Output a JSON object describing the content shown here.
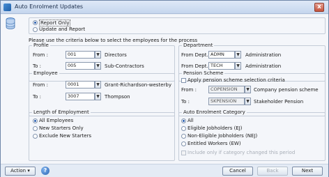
{
  "window": {
    "title": "Auto Enrolment Updates",
    "close_glyph": "x"
  },
  "mode": {
    "report_only": "Report Only",
    "update_and_report": "Update and Report",
    "selected": "report_only"
  },
  "criteria_prompt": "Please use the criteria below to select the employees for the process",
  "profile": {
    "label": "Profile",
    "from_label": "From :",
    "from_value": "001",
    "from_desc": "Directors",
    "to_label": "To :",
    "to_value": "005",
    "to_desc": "Sub-Contractors"
  },
  "department": {
    "label": "Department",
    "from_label": "From Dept. :",
    "from_value": "ADMN",
    "from_desc": "Administration",
    "to_label": "From Dept. :",
    "to_value": "TECH",
    "to_desc": "Administration"
  },
  "employee": {
    "label": "Employee",
    "from_label": "From :",
    "from_value": "0001",
    "from_desc": "Grant-Richardson-westerby",
    "to_label": "To :",
    "to_value": "3007",
    "to_desc": "Thompson"
  },
  "pension": {
    "label": "Pension Scheme",
    "apply_label": "Apply pension scheme selection criteria",
    "from_label": "From :",
    "from_value": "COPENSION",
    "from_desc": "Company pension scheme",
    "to_label": "To :",
    "to_value": "SKPENSION",
    "to_desc": "Stakeholder Pension"
  },
  "length": {
    "label": "Length of Employment",
    "options": [
      "All Employees",
      "New Starters Only",
      "Exclude New Starters"
    ],
    "selected": 0
  },
  "category": {
    "label": "Auto Enrolment Category",
    "options": [
      "All",
      "Eligible Jobholders (EJ)",
      "Non-Eligible Jobholders (NEJ)",
      "Entitled Workers (EW)"
    ],
    "selected": 0,
    "changed_label": "Include only if category changed this period"
  },
  "footer": {
    "action_label": "Action",
    "help_glyph": "?",
    "cancel_label": "Cancel",
    "back_label": "Back",
    "next_label": "Next"
  },
  "icons": {
    "dropdown": "▾",
    "dropdown_arrow_glyph": "▼",
    "action_arrow_glyph": "▾"
  },
  "colors": {
    "accent": "#2b5fb0",
    "window_border": "#6f86a8",
    "panel_bg": "#f4f6fa"
  }
}
